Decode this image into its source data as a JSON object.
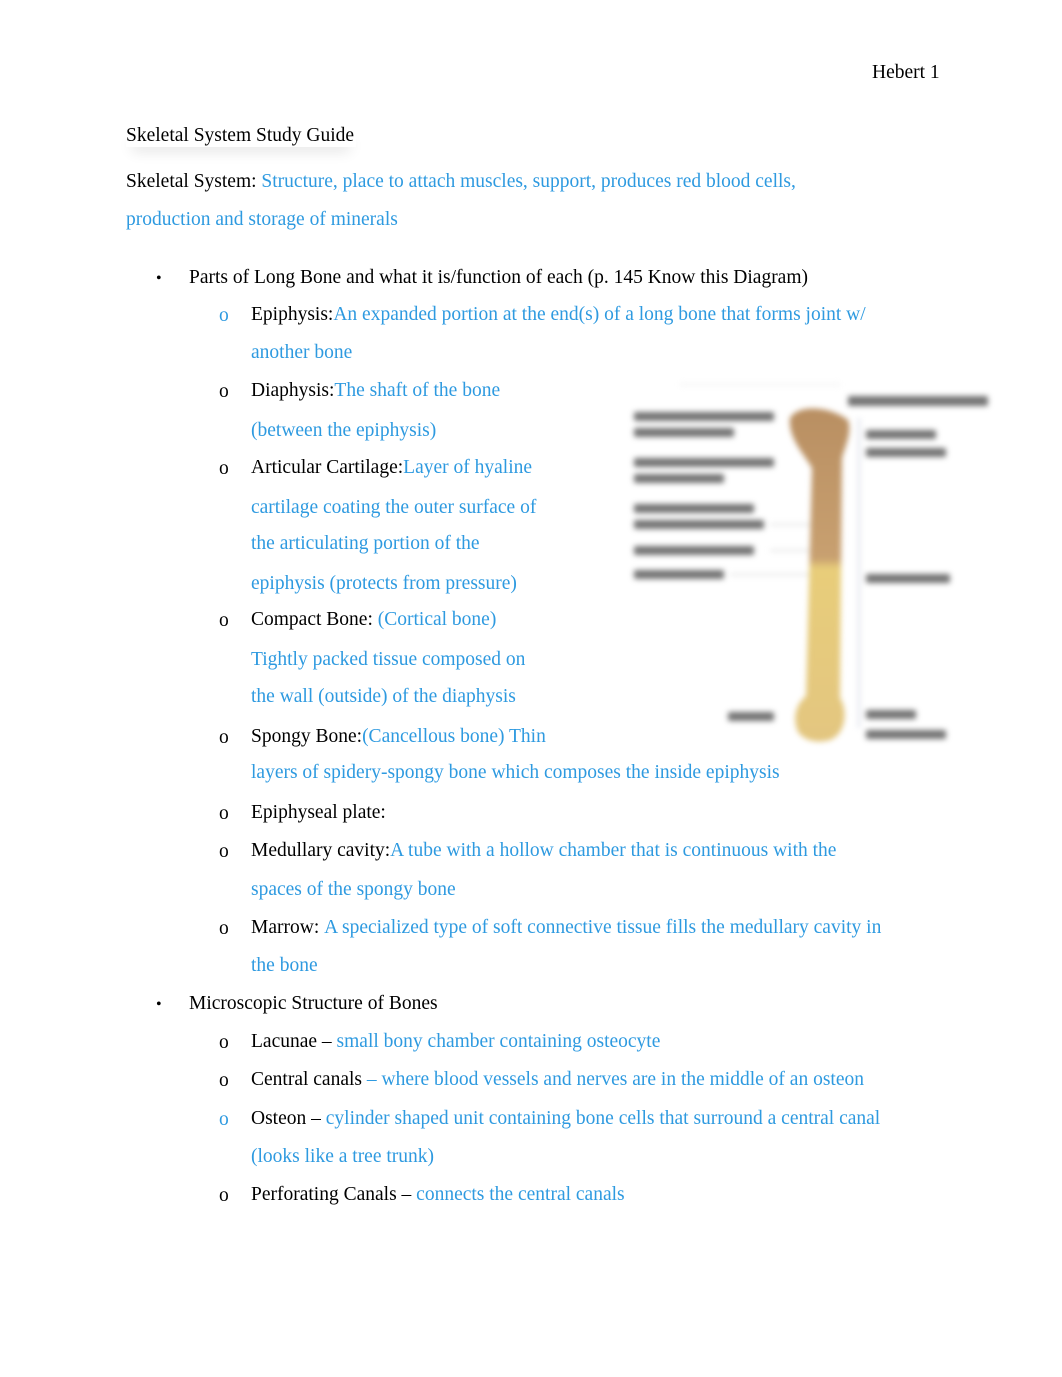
{
  "header": {
    "page_label": "Hebert 1"
  },
  "document": {
    "title": "Skeletal System Study Guide",
    "intro": {
      "term": "Skeletal System:",
      "line1": "Structure, place to attach muscles, support, produces red blood cells,",
      "line2": "production and storage of minerals"
    },
    "sections": [
      {
        "bullet": "•",
        "heading": "Parts of Long Bone and what it is/function of each (p. 145 Know this Diagram)",
        "items": [
          {
            "marker": "o",
            "term": "Epiphysis:",
            "lines": [
              "An expanded portion at the end(s) of a long bone that forms joint w/",
              "another bone"
            ]
          },
          {
            "marker": "o",
            "term": "Diaphysis:",
            "lines": [
              "The shaft of the bone",
              "(between the epiphysis)"
            ]
          },
          {
            "marker": "o",
            "term": "Articular Cartilage:",
            "lines": [
              "Layer of hyaline",
              "cartilage coating the outer surface of",
              "the articulating portion of the",
              "epiphysis (protects from pressure)"
            ]
          },
          {
            "marker": "o",
            "term": "Compact Bone:",
            "lines": [
              "(Cortical bone)",
              "Tightly packed tissue composed on",
              "the wall (outside) of the diaphysis"
            ]
          },
          {
            "marker": "o",
            "term": "Spongy Bone:",
            "lines": [
              "(Cancellous bone) Thin",
              "layers of spidery-spongy bone which composes the inside epiphysis"
            ]
          },
          {
            "marker": "o",
            "term": "Epiphyseal plate:",
            "lines": []
          },
          {
            "marker": "o",
            "term": "Medullary cavity:",
            "lines": [
              "A tube with a hollow chamber that is continuous with the",
              "spaces of the spongy bone"
            ]
          },
          {
            "marker": "o",
            "term": "Marrow:",
            "lines": [
              "A specialized type of soft connective tissue fills the medullary cavity in",
              "the bone"
            ]
          }
        ]
      },
      {
        "bullet": "•",
        "heading": "Microscopic Structure of Bones",
        "items": [
          {
            "marker": "o",
            "term": "Lacunae –",
            "lines": [
              "small bony chamber containing osteocyte"
            ]
          },
          {
            "marker": "o",
            "term": "Central canals",
            "lines": [
              "– where blood vessels and nerves are in the middle of an osteon"
            ]
          },
          {
            "marker": "o",
            "term": "Osteon –",
            "lines": [
              "cylinder shaped unit containing bone cells that surround a central canal",
              "(looks like a tree trunk)"
            ]
          },
          {
            "marker": "o",
            "term": "Perforating Canals –",
            "lines": [
              "connects the central canals"
            ]
          }
        ]
      }
    ],
    "figure": {
      "name": "long-bone-diagram",
      "description": "Blurred labeled diagram of a long bone (femur)"
    }
  },
  "colors": {
    "answer_text": "#2e9ae0",
    "body_text": "#000000",
    "bone_upper": "#b98f62",
    "bone_lower": "#e3c680"
  }
}
